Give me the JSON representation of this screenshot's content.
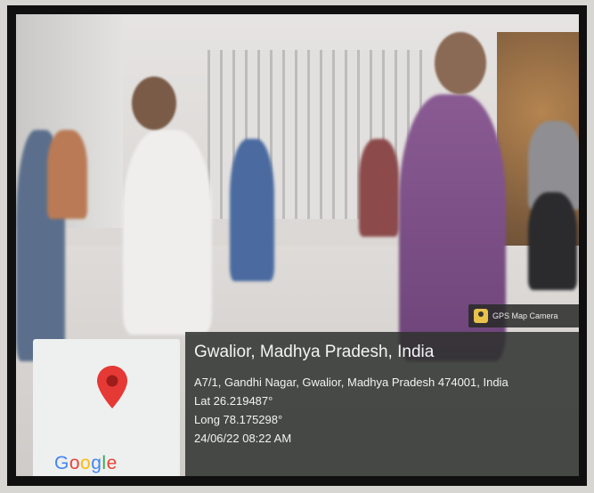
{
  "overlay": {
    "badge": {
      "label": "GPS Map Camera",
      "icon": "gps-camera-app-icon"
    },
    "map": {
      "logo": [
        "G",
        "o",
        "o",
        "g",
        "l",
        "e"
      ],
      "pin_color": "#e53935"
    },
    "location": {
      "title": "Gwalior, Madhya Pradesh, India",
      "address": "A7/1, Gandhi Nagar, Gwalior, Madhya Pradesh 474001, India",
      "lat": "Lat 26.219487°",
      "long": "Long 78.175298°",
      "datetime": "24/06/22 08:22 AM"
    }
  }
}
